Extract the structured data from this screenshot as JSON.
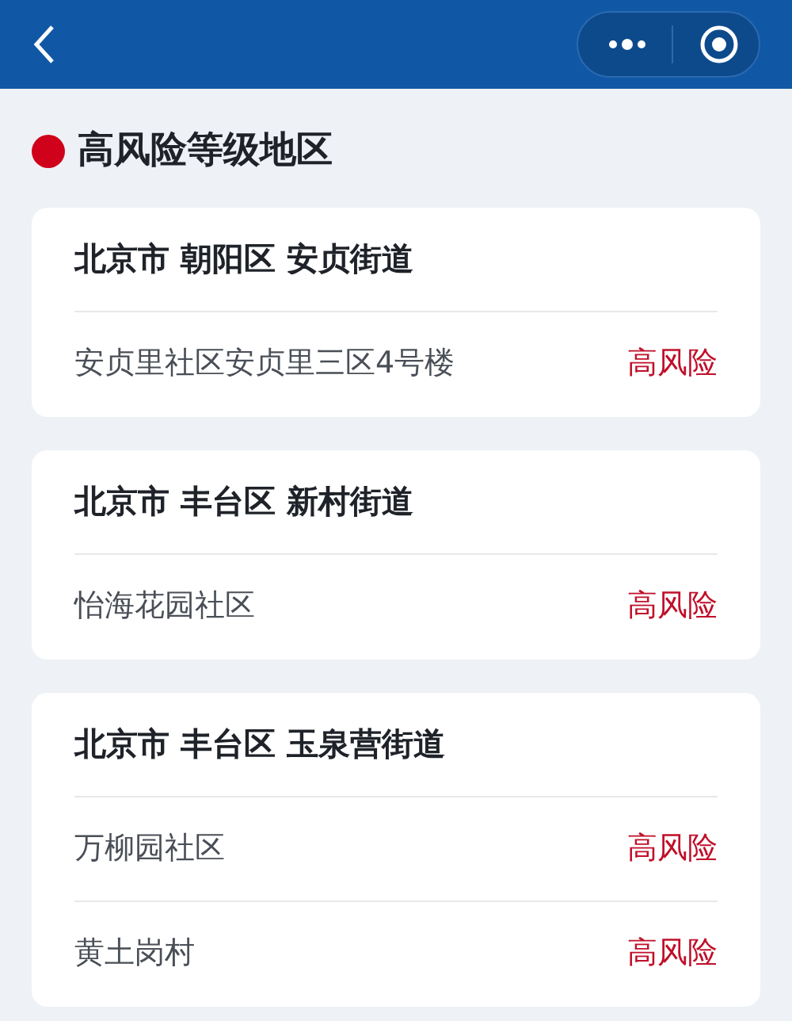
{
  "section": {
    "title": "高风险等级地区"
  },
  "cards": [
    {
      "street": "北京市 朝阳区 安贞街道",
      "places": [
        {
          "name": "安贞里社区安贞里三区4号楼",
          "risk": "高风险"
        }
      ]
    },
    {
      "street": "北京市 丰台区 新村街道",
      "places": [
        {
          "name": "怡海花园社区",
          "risk": "高风险"
        }
      ]
    },
    {
      "street": "北京市 丰台区 玉泉营街道",
      "places": [
        {
          "name": "万柳园社区",
          "risk": "高风险"
        },
        {
          "name": "黄土岗村",
          "risk": "高风险"
        }
      ]
    }
  ]
}
